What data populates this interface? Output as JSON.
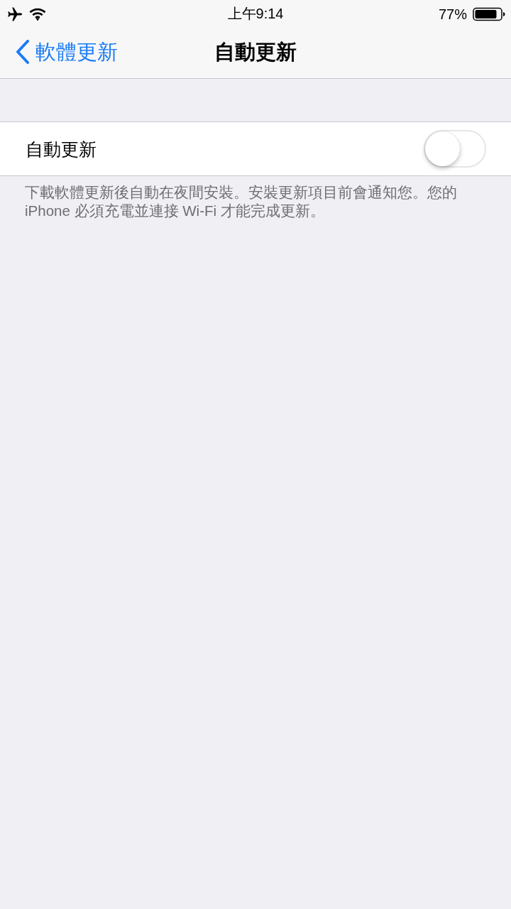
{
  "status_bar": {
    "time": "上午9:14",
    "battery_percent": "77%"
  },
  "nav_bar": {
    "back_label": "軟體更新",
    "title": "自動更新"
  },
  "settings": [
    {
      "kind": "toggle",
      "label": "自動更新",
      "on": false
    }
  ],
  "footer": "下載軟體更新後自動在夜間安裝。安裝更新項目前會通知您。您的 iPhone 必須充電並連接 Wi-Fi 才能完成更新。"
}
